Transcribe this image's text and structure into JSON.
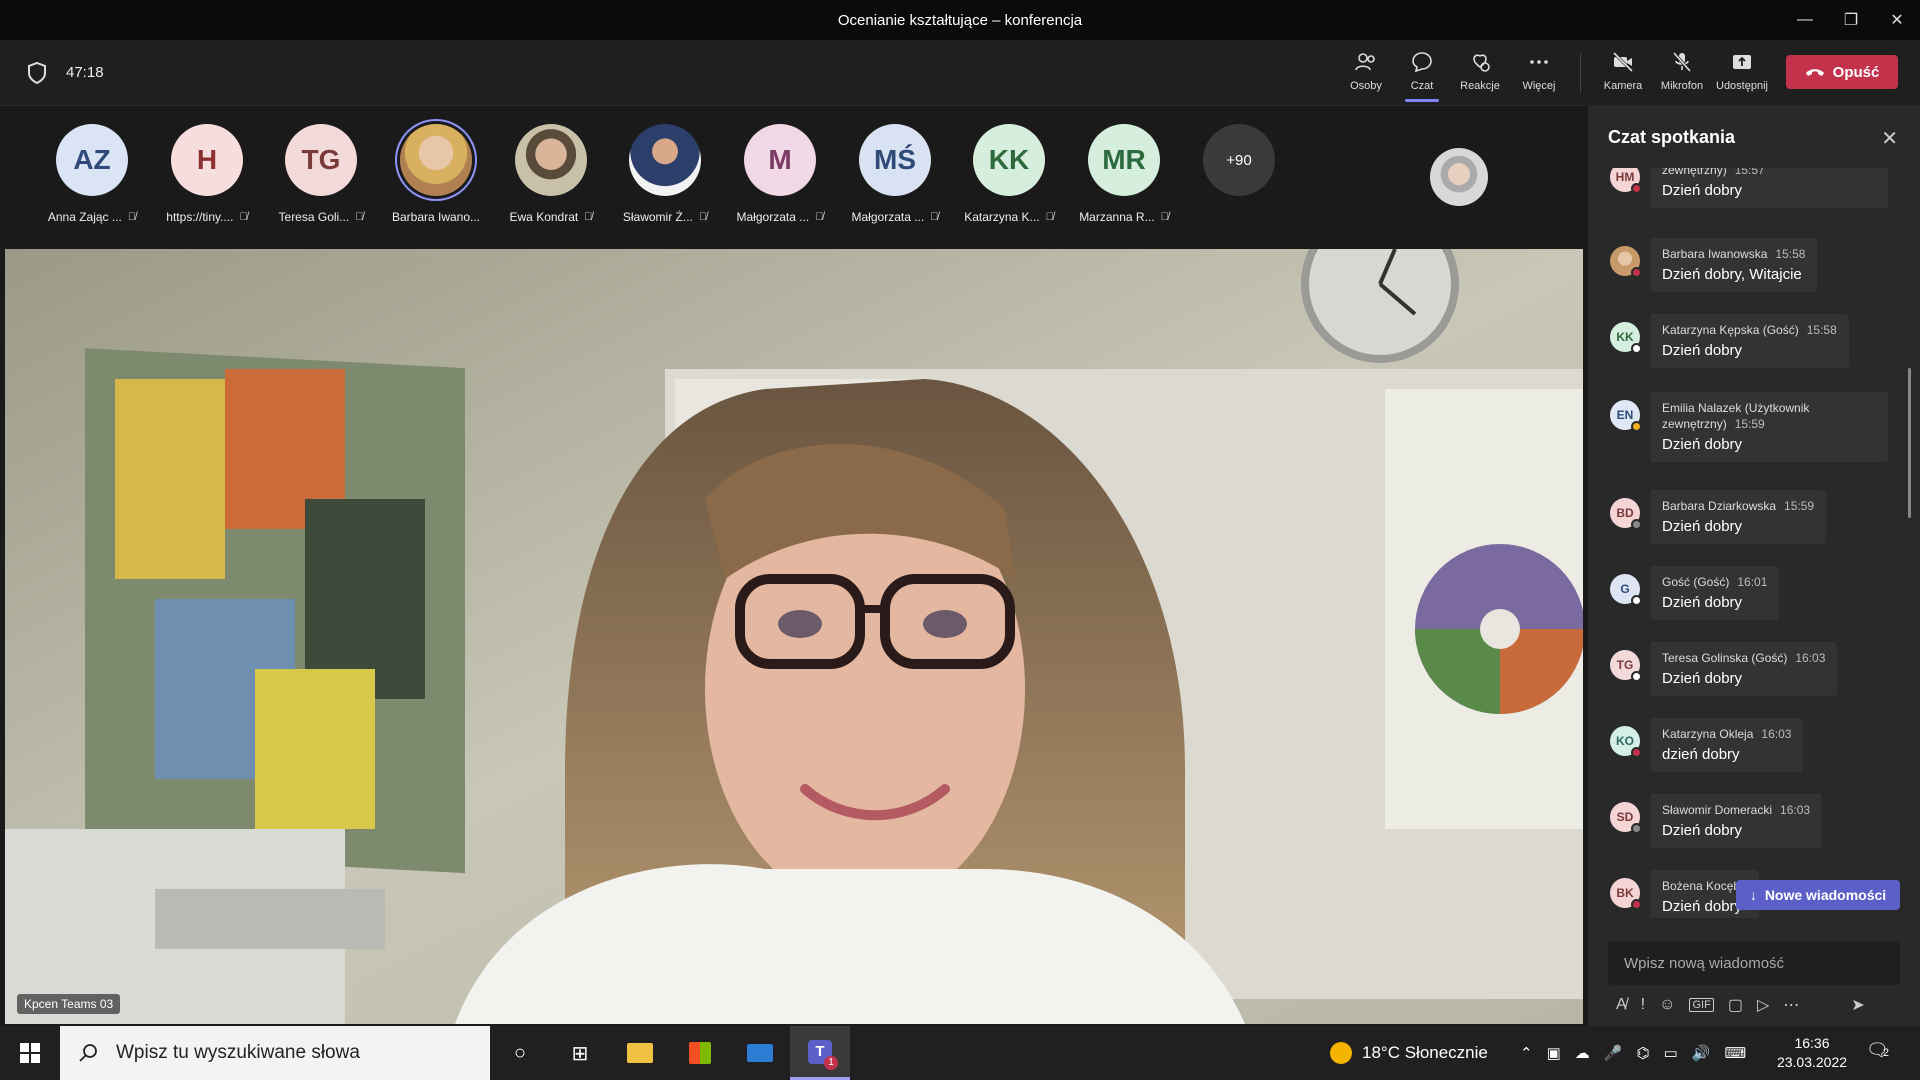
{
  "window": {
    "title": "Ocenianie kształtujące – konferencja"
  },
  "meeting": {
    "timer": "47:18"
  },
  "toolbar": {
    "people": "Osoby",
    "chat": "Czat",
    "reactions": "Reakcje",
    "more": "Więcej",
    "camera": "Kamera",
    "mic": "Mikrofon",
    "share": "Udostępnij",
    "leave": "Opuść"
  },
  "participants": [
    {
      "initials": "AZ",
      "name": "Anna Zając ...",
      "bg": "#dbe4f4",
      "fg": "#2f4a7a"
    },
    {
      "initials": "H",
      "name": "https://tiny....",
      "bg": "#f7dede",
      "fg": "#8a3030"
    },
    {
      "initials": "TG",
      "name": "Teresa Goli...",
      "bg": "#f3dada",
      "fg": "#7a3a3a"
    },
    {
      "initials": "",
      "name": "Barbara Iwano...",
      "bg": "#c9a07a",
      "fg": "#fff"
    },
    {
      "initials": "",
      "name": "Ewa Kondrat",
      "bg": "#8a7b5a",
      "fg": "#fff"
    },
    {
      "initials": "",
      "name": "Sławomir Ż...",
      "bg": "#e8ecf2",
      "fg": "#333"
    },
    {
      "initials": "M",
      "name": "Małgorzata ...",
      "bg": "#f0d8e6",
      "fg": "#7a3a62"
    },
    {
      "initials": "MŚ",
      "name": "Małgorzata ...",
      "bg": "#d8e2f2",
      "fg": "#2e4a78"
    },
    {
      "initials": "KK",
      "name": "Katarzyna K...",
      "bg": "#d6eedd",
      "fg": "#2d6a3e"
    },
    {
      "initials": "MR",
      "name": "Marzanna R...",
      "bg": "#d6eedd",
      "fg": "#2d6a3e"
    }
  ],
  "overflow_count": "+90",
  "video": {
    "name_tag": "Kpcen Teams 03"
  },
  "chat": {
    "title": "Czat spotkania",
    "messages": [
      {
        "initials": "HM",
        "author": "zewnętrzny)",
        "time": "15:57",
        "text": "Dzień dobry",
        "status": "#c4314b",
        "av_bg": "#f4d4d4",
        "av_fg": "#7a3a3a"
      },
      {
        "initials": "",
        "author": "Barbara Iwanowska",
        "time": "15:58",
        "text": "Dzień dobry, Witajcie",
        "status": "#c4314b",
        "av_bg": "#c9a07a",
        "av_fg": "#fff"
      },
      {
        "initials": "KK",
        "author": "Katarzyna Kępska (Gość)",
        "time": "15:58",
        "text": "Dzień dobry",
        "status": "#ffffff",
        "av_bg": "#d6eedd",
        "av_fg": "#2d6a3e"
      },
      {
        "initials": "EN",
        "author": "Emilia Nalazek (Użytkownik",
        "author2": "zewnętrzny)",
        "time": "15:59",
        "text": "Dzień dobry",
        "status": "#f2b01e",
        "av_bg": "#dfe8f4",
        "av_fg": "#2f4a7a"
      },
      {
        "initials": "BD",
        "author": "Barbara Dziarkowska",
        "time": "15:59",
        "text": "Dzień dobry",
        "status": "#888888",
        "av_bg": "#f4d4d4",
        "av_fg": "#7a3a3a"
      },
      {
        "initials": "G",
        "author": "Gość (Gość)",
        "time": "16:01",
        "text": "Dzień dobry",
        "status": "#ffffff",
        "av_bg": "#dfe4f4",
        "av_fg": "#2f4a7a"
      },
      {
        "initials": "TG",
        "author": "Teresa Golinska (Gość)",
        "time": "16:03",
        "text": "Dzień dobry",
        "status": "#ffffff",
        "av_bg": "#f3dada",
        "av_fg": "#7a3a3a"
      },
      {
        "initials": "KO",
        "author": "Katarzyna Okleja",
        "time": "16:03",
        "text": "dzień dobry",
        "status": "#c4314b",
        "av_bg": "#d6eee8",
        "av_fg": "#2d6a5e"
      },
      {
        "initials": "SD",
        "author": "Sławomir Domeracki",
        "time": "16:03",
        "text": "Dzień dobry",
        "status": "#888888",
        "av_bg": "#f4d4d4",
        "av_fg": "#7a3a3a"
      },
      {
        "initials": "BK",
        "author": "Bożena Kocęba",
        "time": "",
        "text": "Dzień dobry",
        "status": "#c4314b",
        "av_bg": "#f4d4d4",
        "av_fg": "#7a3a3a"
      }
    ],
    "new_messages": "Nowe wiadomości",
    "compose_placeholder": "Wpisz nową wiadomość"
  },
  "taskbar": {
    "search_placeholder": "Wpisz tu wyszukiwane słowa",
    "weather": "18°C Słonecznie",
    "time": "16:36",
    "date": "23.03.2022",
    "notifications": "2",
    "teams_badge": "1"
  }
}
